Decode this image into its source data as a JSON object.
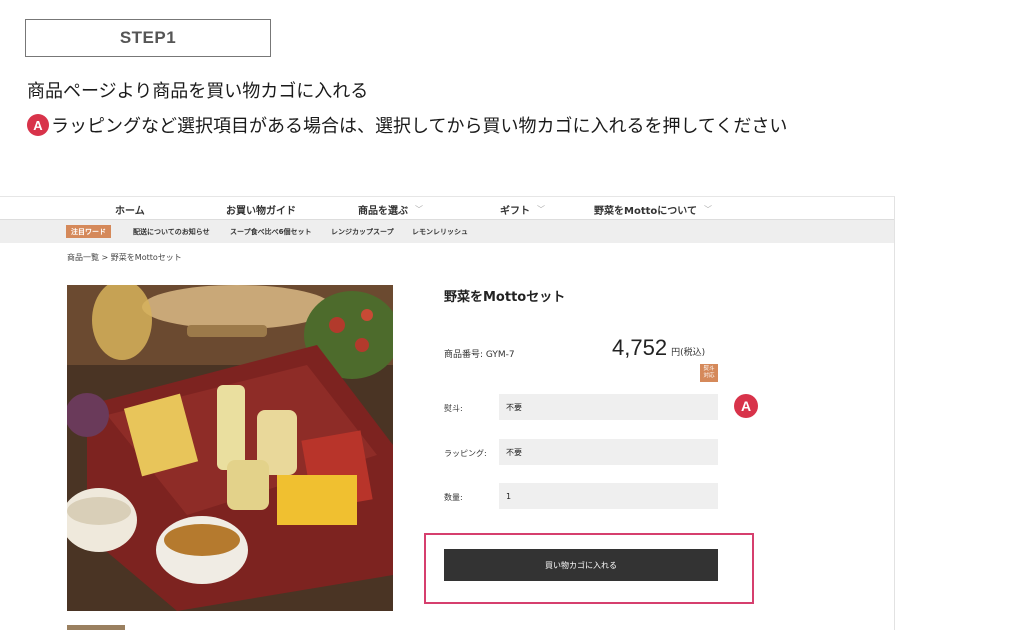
{
  "step": {
    "label": "STEP1"
  },
  "instructions": {
    "line1": "商品ページより商品を買い物カゴに入れる",
    "line2_marker": "A",
    "line2": "ラッピングなど選択項目がある場合は、選択してから買い物カゴに入れるを押してください"
  },
  "site": {
    "nav": {
      "home": "ホーム",
      "guide": "お買い物ガイド",
      "select": "商品を選ぶ",
      "gift": "ギフト",
      "about": "野菜をMottoについて",
      "chevron": "﹀"
    },
    "keywords": {
      "tag": "注目ワード",
      "links": [
        "配送についてのお知らせ",
        "スープ食べ比べ6個セット",
        "レンジカップスープ",
        "レモンレリッシュ"
      ]
    },
    "breadcrumb": "商品一覧 > 野菜をMottoセット",
    "product": {
      "title": "野菜をMottoセット",
      "code": "商品番号: GYM-7",
      "price": "4,752",
      "price_unit": "円(税込)",
      "noshi_badge": [
        "熨斗",
        "対応"
      ],
      "options": [
        {
          "label": "熨斗:",
          "value": "不要"
        },
        {
          "label": "ラッピング:",
          "value": "不要"
        },
        {
          "label": "数量:",
          "value": "1"
        }
      ],
      "marker": "A",
      "cart_button": "買い物カゴに入れる"
    }
  },
  "colors": {
    "accent_red": "#d8334a",
    "highlight_pink": "#d63f6e",
    "tag_orange": "#d5895a",
    "button_dark": "#333333"
  }
}
